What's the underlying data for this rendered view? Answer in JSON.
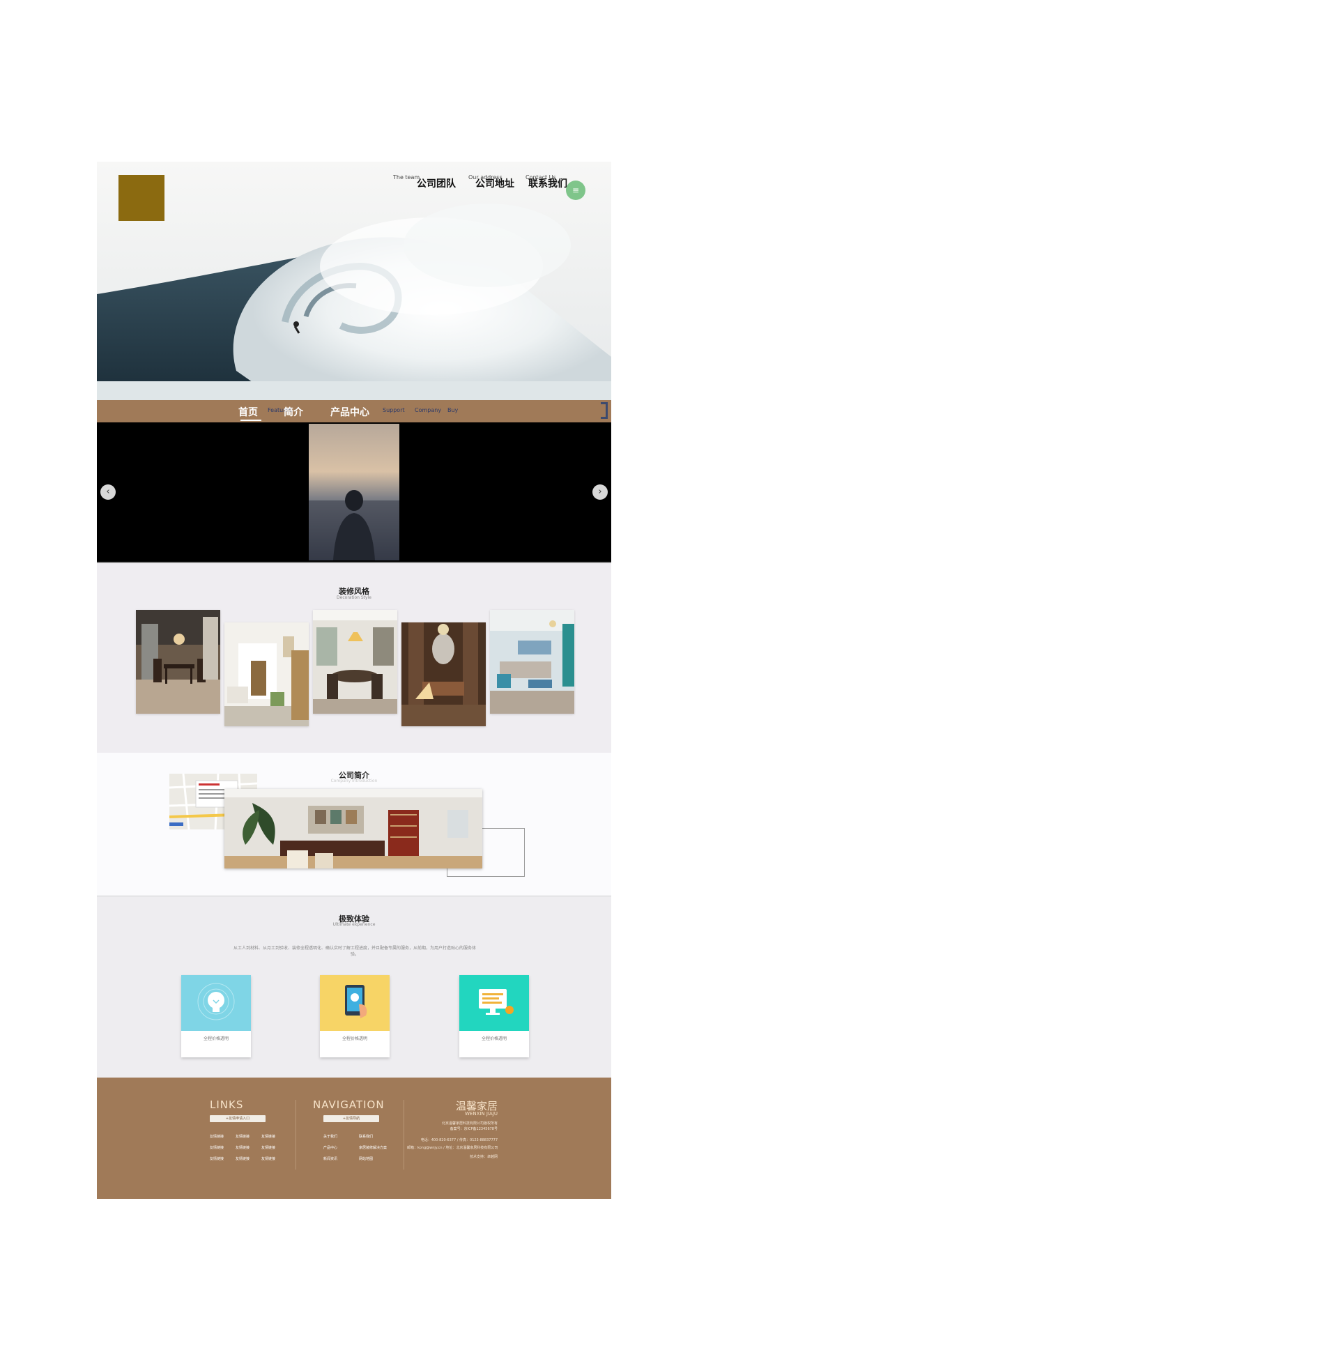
{
  "header": {
    "top_nav": [
      {
        "en": "The team",
        "zh": "公司团队"
      },
      {
        "en": "Our address",
        "zh": "公司地址"
      },
      {
        "en": "Contact Us",
        "zh": "联系我们"
      }
    ],
    "menu_icon": "≡"
  },
  "main_nav": {
    "items": [
      {
        "zh": "首页",
        "en": ""
      },
      {
        "zh": "简介",
        "en": "Features"
      },
      {
        "zh": "产品中心",
        "en": ""
      },
      {
        "zh": "",
        "en": "Support"
      },
      {
        "zh": "",
        "en": "Company"
      },
      {
        "zh": "",
        "en": "Buy"
      }
    ]
  },
  "slider": {
    "prev_icon": "‹",
    "next_icon": "›"
  },
  "decoration": {
    "title": "装修风格",
    "subtitle": "Decoration Style"
  },
  "intro": {
    "title": "公司简介",
    "subtitle": "Company Introduction"
  },
  "experience": {
    "title": "极致体验",
    "subtitle": "Ultimate experience",
    "description": "从工人到材料、从月工到验收、装修全程透明化、确认实时了解工程进度，并且配备专属的服务，从前期，为用户打造贴心的服务体验。",
    "cards": [
      {
        "label": "全程价格透明",
        "color": "#7fd5e6",
        "icon": "lightbulb-icon"
      },
      {
        "label": "全程价格透明",
        "color": "#f7d466",
        "icon": "tablet-icon"
      },
      {
        "label": "全程价格透明",
        "color": "#22d6bf",
        "icon": "monitor-icon"
      }
    ]
  },
  "footer": {
    "links_title": "LINKS",
    "links_button": "+友情申请入口",
    "links": [
      [
        "友情链接",
        "友情链接",
        "友情链接"
      ],
      [
        "友情链接",
        "友情链接",
        "友情链接"
      ],
      [
        "友情链接",
        "友情链接",
        "友情链接"
      ]
    ],
    "nav_title": "NAVIGATION",
    "nav_button": "+友情导航",
    "nav_links": [
      [
        "关于我们",
        "联系我们"
      ],
      [
        "产品中心",
        "家居装修解决方案"
      ],
      [
        "新闻资讯",
        "网站地图"
      ]
    ],
    "brand_zh": "温馨家居",
    "brand_en": "WENXIN JIAJU",
    "company": "北京温馨家居科技有限公司版权所有",
    "icp": "备案号：京ICP备12345678号",
    "phone": "电话：400-820-6377 / 传真：0123-88837777",
    "email": "邮箱：kong@wnjy.cn / 地址：北京温馨家居科技有限公司",
    "support": "技术支持：卓越网"
  },
  "colors": {
    "brown": "#a07a58",
    "logo": "#8b6a10",
    "menu_green": "#7fc58a"
  }
}
